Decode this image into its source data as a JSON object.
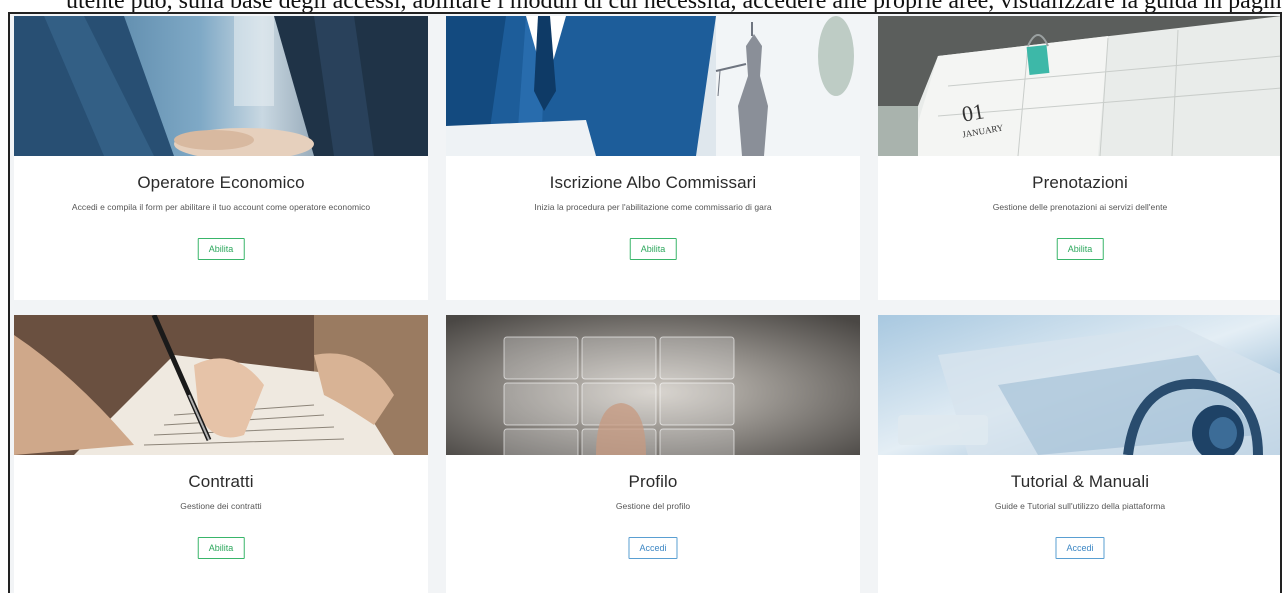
{
  "caption": "utente può, sulla base degli accessi, abilitare i moduli di cui necessita, accedere alle proprie aree, visualizzare la guida in pagina (Tutorial e Manuali) o il manuale utente nella sua interezza",
  "cards": [
    {
      "title": "Operatore Economico",
      "description": "Accedi e compila il form per abilitare il tuo account come operatore economico",
      "button": "Abilita",
      "button_type": "abilita"
    },
    {
      "title": "Iscrizione Albo Commissari",
      "description": "Inizia la procedura per l'abilitazione come commissario di gara",
      "button": "Abilita",
      "button_type": "abilita"
    },
    {
      "title": "Prenotazioni",
      "description": "Gestione delle prenotazioni ai servizi dell'ente",
      "button": "Abilita",
      "button_type": "abilita"
    },
    {
      "title": "Contratti",
      "description": "Gestione dei contratti",
      "button": "Abilita",
      "button_type": "abilita"
    },
    {
      "title": "Profilo",
      "description": "Gestione del profilo",
      "button": "Accedi",
      "button_type": "accedi"
    },
    {
      "title": "Tutorial & Manuali",
      "description": "Guide e Tutorial sull'utilizzo della piattaforma",
      "button": "Accedi",
      "button_type": "accedi"
    }
  ],
  "images": {
    "calendar_day": "01",
    "calendar_month": "JANUARY"
  },
  "colors": {
    "abilita": "#39b56a",
    "accedi": "#5a9fd2",
    "background": "#f2f4f6"
  }
}
